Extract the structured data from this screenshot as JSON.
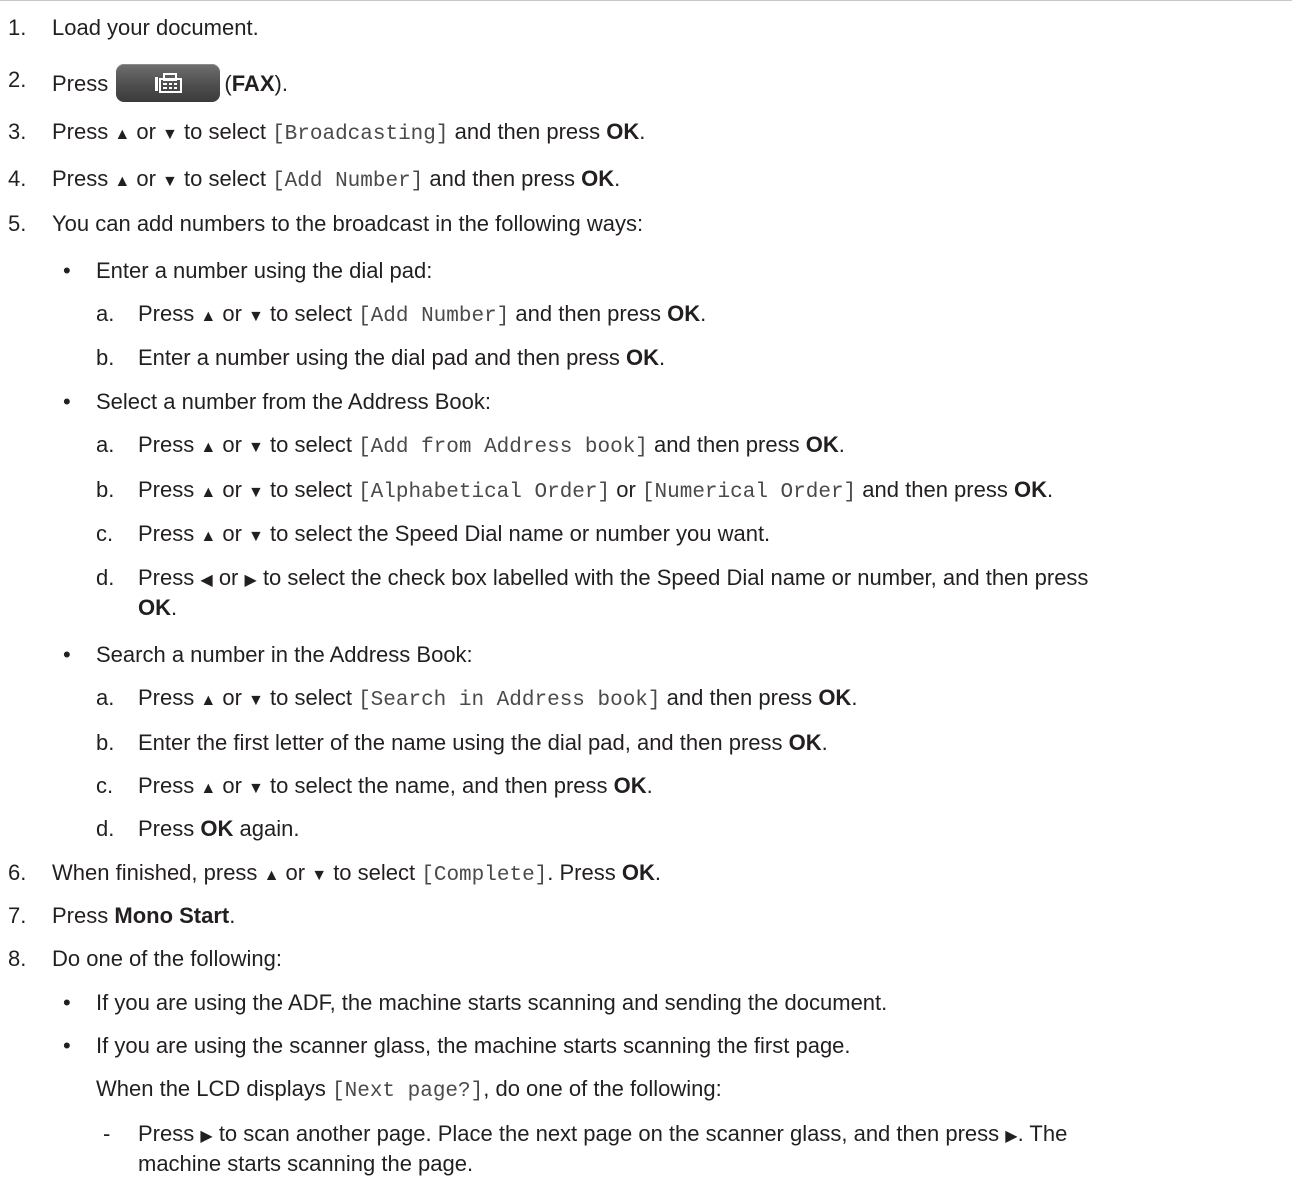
{
  "steps": [
    {
      "num": "1.",
      "text": "Load your document."
    },
    {
      "num": "2.",
      "pre": "Press",
      "icon": "fax-icon",
      "post_open": "(",
      "post_bold": "FAX",
      "post_close": ")."
    },
    {
      "num": "3.",
      "pre": "Press",
      "up": "▲",
      "or": "or",
      "down": "▼",
      "to": "to select",
      "code": "[Broadcasting]",
      "mid": "and then press",
      "ok": "OK",
      "end": "."
    },
    {
      "num": "4.",
      "pre": "Press",
      "up": "▲",
      "or": "or",
      "down": "▼",
      "to": "to select",
      "code": "[Add Number]",
      "mid": "and then press",
      "ok": "OK",
      "end": "."
    },
    {
      "num": "5.",
      "text": "You can add numbers to the broadcast in the following ways:"
    },
    {
      "num": "6.",
      "pre": "When finished, press",
      "up": "▲",
      "or": "or",
      "down": "▼",
      "to": "to select",
      "code": "[Complete]",
      "mid": ". Press",
      "ok": "OK",
      "end": "."
    },
    {
      "num": "7.",
      "pre": "Press",
      "bold": "Mono Start",
      "end": "."
    },
    {
      "num": "8.",
      "text": "Do one of the following:"
    }
  ],
  "bullet": "•",
  "dash": "-",
  "step5": {
    "b1": "Enter a number using the dial pad:",
    "b1a": {
      "marker": "a.",
      "pre": "Press",
      "code": "[Add Number]",
      "mid": "and then press",
      "ok": "OK",
      "end": "."
    },
    "b1b": {
      "marker": "b.",
      "pre": "Enter a number using the dial pad and then press",
      "ok": "OK",
      "end": "."
    },
    "b2": "Select a number from the Address Book:",
    "b2a": {
      "marker": "a.",
      "pre": "Press",
      "code": "[Add from Address book]",
      "mid": "and then press",
      "ok": "OK",
      "end": "."
    },
    "b2b": {
      "marker": "b.",
      "pre": "Press",
      "code": "[Alphabetical Order]",
      "or2": "or",
      "code2": "[Numerical Order]",
      "mid": "and then press",
      "ok": "OK",
      "end": "."
    },
    "b2c": {
      "marker": "c.",
      "pre": "Press",
      "rest": "to select the Speed Dial name or number you want."
    },
    "b2d": {
      "marker": "d.",
      "pre": "Press",
      "left": "◀",
      "right": "▶",
      "rest": "to select the check box labelled with the Speed Dial name or number, and then press",
      "ok": "OK",
      "end": "."
    },
    "b3": "Search a number in the Address Book:",
    "b3a": {
      "marker": "a.",
      "pre": "Press",
      "code": "[Search in Address book]",
      "mid": "and then press",
      "ok": "OK",
      "end": "."
    },
    "b3b": {
      "marker": "b.",
      "pre": "Enter the first letter of the name using the dial pad, and then press",
      "ok": "OK",
      "end": "."
    },
    "b3c": {
      "marker": "c.",
      "pre": "Press",
      "rest": "to select the name, and then press",
      "ok": "OK",
      "end": "."
    },
    "b3d": {
      "marker": "d.",
      "pre": "Press",
      "ok": "OK",
      "rest": "again."
    }
  },
  "step8": {
    "b1": "If you are using the ADF, the machine starts scanning and sending the document.",
    "b2": "If you are using the scanner glass, the machine starts scanning the first page.",
    "lcd_pre": "When the LCD displays",
    "lcd_code": "[Next page?]",
    "lcd_post": ", do one of the following:",
    "d1_pre": "Press",
    "d1_right": "▶",
    "d1_mid": "to scan another page. Place the next page on the scanner glass, and then press",
    "d1_end": ". The",
    "d1_line2": "machine starts scanning the page."
  },
  "common": {
    "up": "▲",
    "or": "or",
    "down": "▼",
    "to": "to select"
  }
}
